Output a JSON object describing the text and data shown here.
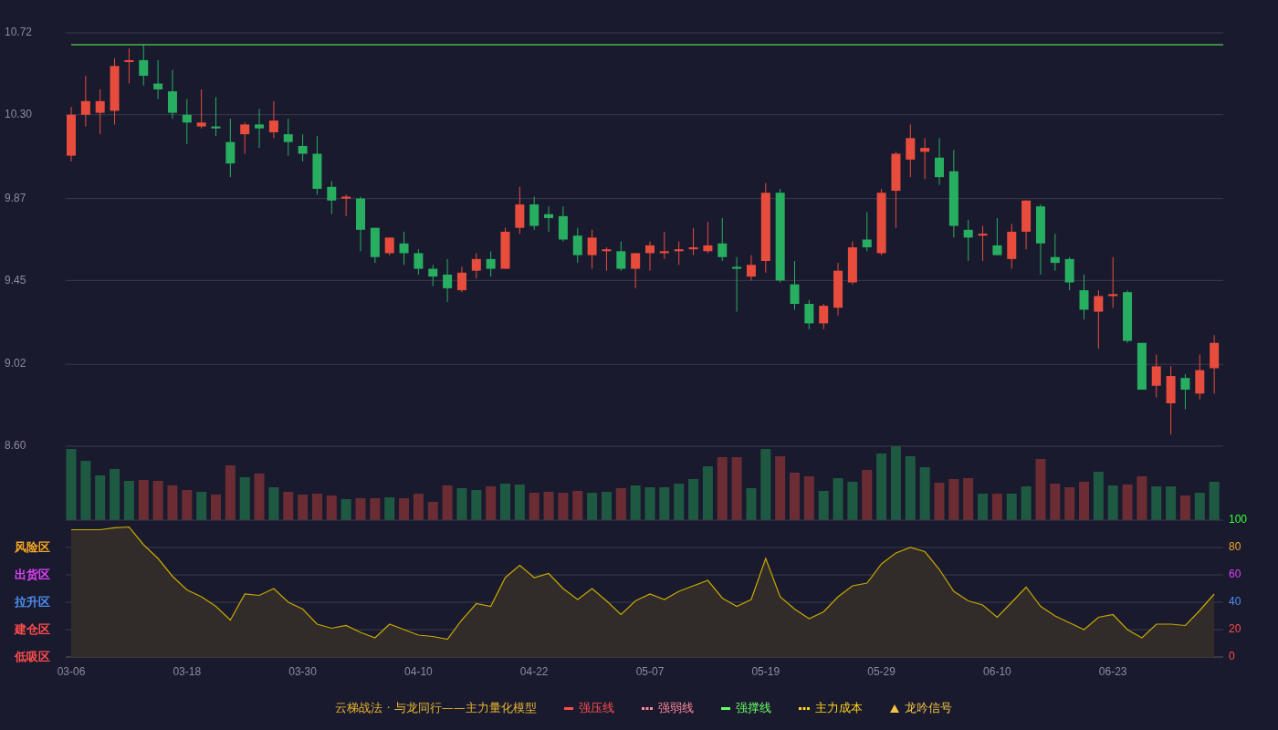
{
  "price_chart": {
    "chart_data": {
      "type": "candlestick",
      "ylim": [
        8.6,
        10.72
      ],
      "grid": true,
      "yticks": [
        {
          "value": 10.72,
          "label": "10.72"
        },
        {
          "value": 10.3,
          "label": "10.30"
        },
        {
          "value": 9.87,
          "label": "9.87"
        },
        {
          "value": 9.45,
          "label": "9.45"
        },
        {
          "value": 9.02,
          "label": "9.02"
        },
        {
          "value": 8.6,
          "label": "8.60"
        }
      ],
      "categories": [
        null,
        null,
        null,
        null,
        null,
        null,
        null,
        null,
        null,
        null,
        null,
        null,
        null,
        null,
        null,
        null,
        null,
        null,
        null,
        null,
        null,
        null,
        null,
        null,
        null,
        null,
        null,
        null,
        null,
        null,
        null,
        null,
        null,
        null,
        null,
        null,
        null,
        null,
        null,
        null,
        null,
        null,
        null,
        null,
        null,
        null,
        null,
        null,
        null,
        null,
        null,
        null,
        null,
        null,
        null,
        null,
        null,
        null,
        null,
        null,
        null,
        null,
        null,
        null,
        null,
        null,
        null,
        null,
        null,
        null,
        null,
        null,
        null,
        null,
        null,
        null,
        null,
        null,
        null,
        null
      ],
      "ohlc": [
        [
          10.09,
          10.34,
          10.06,
          10.3
        ],
        [
          10.3,
          10.5,
          10.24,
          10.37
        ],
        [
          10.31,
          10.43,
          10.2,
          10.37
        ],
        [
          10.32,
          10.59,
          10.25,
          10.55
        ],
        [
          10.57,
          10.64,
          10.46,
          10.58
        ],
        [
          10.58,
          10.66,
          10.45,
          10.5
        ],
        [
          10.46,
          10.58,
          10.38,
          10.43
        ],
        [
          10.42,
          10.53,
          10.28,
          10.31
        ],
        [
          10.3,
          10.38,
          10.15,
          10.26
        ],
        [
          10.24,
          10.43,
          10.23,
          10.26
        ],
        [
          10.24,
          10.39,
          10.19,
          10.23
        ],
        [
          10.16,
          10.28,
          9.98,
          10.05
        ],
        [
          10.2,
          10.26,
          10.1,
          10.25
        ],
        [
          10.25,
          10.33,
          10.13,
          10.23
        ],
        [
          10.21,
          10.37,
          10.18,
          10.27
        ],
        [
          10.2,
          10.28,
          10.09,
          10.16
        ],
        [
          10.14,
          10.2,
          10.06,
          10.1
        ],
        [
          10.1,
          10.19,
          9.89,
          9.92
        ],
        [
          9.93,
          9.96,
          9.79,
          9.86
        ],
        [
          9.87,
          9.89,
          9.78,
          9.88
        ],
        [
          9.87,
          9.88,
          9.6,
          9.71
        ],
        [
          9.72,
          9.72,
          9.54,
          9.57
        ],
        [
          9.59,
          9.67,
          9.58,
          9.67
        ],
        [
          9.64,
          9.7,
          9.53,
          9.59
        ],
        [
          9.59,
          9.61,
          9.48,
          9.51
        ],
        [
          9.51,
          9.53,
          9.42,
          9.47
        ],
        [
          9.48,
          9.56,
          9.34,
          9.41
        ],
        [
          9.4,
          9.52,
          9.39,
          9.49
        ],
        [
          9.5,
          9.59,
          9.46,
          9.56
        ],
        [
          9.56,
          9.6,
          9.47,
          9.51
        ],
        [
          9.51,
          9.72,
          9.51,
          9.7
        ],
        [
          9.72,
          9.93,
          9.69,
          9.84
        ],
        [
          9.84,
          9.88,
          9.71,
          9.73
        ],
        [
          9.79,
          9.83,
          9.7,
          9.77
        ],
        [
          9.78,
          9.83,
          9.65,
          9.66
        ],
        [
          9.68,
          9.72,
          9.54,
          9.58
        ],
        [
          9.58,
          9.71,
          9.51,
          9.67
        ],
        [
          9.6,
          9.62,
          9.5,
          9.61
        ],
        [
          9.6,
          9.65,
          9.5,
          9.51
        ],
        [
          9.51,
          9.59,
          9.41,
          9.59
        ],
        [
          9.59,
          9.65,
          9.5,
          9.63
        ],
        [
          9.59,
          9.7,
          9.56,
          9.6
        ],
        [
          9.6,
          9.65,
          9.53,
          9.61
        ],
        [
          9.61,
          9.72,
          9.58,
          9.62
        ],
        [
          9.6,
          9.75,
          9.59,
          9.63
        ],
        [
          9.64,
          9.77,
          9.55,
          9.57
        ],
        [
          9.52,
          9.57,
          9.29,
          9.51
        ],
        [
          9.47,
          9.58,
          9.45,
          9.53
        ],
        [
          9.55,
          9.95,
          9.49,
          9.9
        ],
        [
          9.9,
          9.92,
          9.44,
          9.45
        ],
        [
          9.43,
          9.55,
          9.3,
          9.33
        ],
        [
          9.33,
          9.35,
          9.2,
          9.23
        ],
        [
          9.23,
          9.33,
          9.2,
          9.32
        ],
        [
          9.31,
          9.54,
          9.27,
          9.5
        ],
        [
          9.44,
          9.65,
          9.43,
          9.62
        ],
        [
          9.66,
          9.8,
          9.6,
          9.62
        ],
        [
          9.59,
          9.92,
          9.58,
          9.9
        ],
        [
          9.91,
          10.11,
          9.72,
          10.1
        ],
        [
          10.07,
          10.25,
          9.98,
          10.18
        ],
        [
          10.11,
          10.18,
          9.97,
          10.13
        ],
        [
          10.08,
          10.18,
          9.94,
          9.98
        ],
        [
          10.01,
          10.12,
          9.67,
          9.73
        ],
        [
          9.71,
          9.76,
          9.55,
          9.67
        ],
        [
          9.68,
          9.73,
          9.55,
          9.69
        ],
        [
          9.63,
          9.77,
          9.58,
          9.58
        ],
        [
          9.56,
          9.74,
          9.51,
          9.7
        ],
        [
          9.7,
          9.86,
          9.61,
          9.86
        ],
        [
          9.83,
          9.84,
          9.48,
          9.64
        ],
        [
          9.57,
          9.69,
          9.5,
          9.54
        ],
        [
          9.56,
          9.57,
          9.4,
          9.44
        ],
        [
          9.4,
          9.48,
          9.25,
          9.3
        ],
        [
          9.29,
          9.4,
          9.1,
          9.37
        ],
        [
          9.37,
          9.57,
          9.31,
          9.38
        ],
        [
          9.39,
          9.4,
          9.13,
          9.14
        ],
        [
          9.13,
          9.13,
          8.89,
          8.89
        ],
        [
          8.91,
          9.07,
          8.85,
          9.01
        ],
        [
          8.82,
          9.01,
          8.66,
          8.96
        ],
        [
          8.95,
          8.97,
          8.79,
          8.89
        ],
        [
          8.87,
          9.07,
          8.84,
          8.99
        ],
        [
          9.0,
          9.17,
          8.87,
          9.13
        ]
      ]
    }
  },
  "oscillator": {
    "zones": [
      {
        "color": "#33ff33"
      },
      {
        "label": "风险区",
        "color": "#f5a623"
      },
      {
        "label": "出货区",
        "color": "#e040fb"
      },
      {
        "label": "拉升区",
        "color": "#4d8ef0"
      },
      {
        "label": "建仓区",
        "color": "#ff4d4d"
      },
      {
        "label": "低吸区",
        "color": "#ff4d4d"
      }
    ],
    "chart_data": {
      "type": "area",
      "ylim": [
        0,
        100
      ],
      "grid": true,
      "categories": [
        "03-06",
        null,
        null,
        null,
        null,
        null,
        null,
        null,
        "03-18",
        null,
        null,
        null,
        null,
        null,
        null,
        null,
        "03-30",
        null,
        null,
        null,
        null,
        null,
        null,
        null,
        "04-10",
        null,
        null,
        null,
        null,
        null,
        null,
        null,
        "04-22",
        null,
        null,
        null,
        null,
        null,
        null,
        null,
        "05-07",
        null,
        null,
        null,
        null,
        null,
        null,
        null,
        "05-19",
        null,
        null,
        null,
        null,
        null,
        null,
        null,
        "05-29",
        null,
        null,
        null,
        null,
        null,
        null,
        null,
        "06-10",
        null,
        null,
        null,
        null,
        null,
        null,
        null,
        "06-23",
        null,
        null,
        null,
        null,
        null,
        null,
        null
      ],
      "yticks": [
        {
          "value": 100,
          "label": "100"
        },
        {
          "value": 80,
          "label": "80"
        },
        {
          "value": 60,
          "label": "60"
        },
        {
          "value": 40,
          "label": "40"
        },
        {
          "value": 20,
          "label": "20"
        },
        {
          "value": 0,
          "label": "0"
        }
      ],
      "series": [
        {
          "color": "#c8a800",
          "values": [
            93,
            93,
            93,
            94.5,
            95,
            82,
            72,
            59,
            49,
            44,
            37,
            27,
            46,
            45,
            50,
            40,
            35,
            24,
            21,
            23,
            18,
            14,
            24,
            20,
            16,
            15,
            13,
            27,
            39,
            37,
            58,
            67,
            58,
            61,
            50,
            42,
            50,
            41,
            31,
            41,
            46,
            42,
            48,
            52,
            56,
            43,
            37,
            42,
            72,
            44,
            35,
            28,
            33,
            44,
            52,
            54,
            68,
            76,
            80,
            77,
            64,
            48,
            41,
            38,
            29,
            40,
            51,
            37,
            30,
            25,
            20,
            29,
            31,
            20,
            14,
            24,
            24,
            23,
            34,
            46
          ]
        }
      ]
    }
  },
  "legend": {
    "title": "云梯战法 · 与龙同行——主力量化模型",
    "items": [
      {
        "kind": "solid",
        "label": "强压线",
        "color": "#ff4d4d"
      },
      {
        "kind": "dashed",
        "label": "强弱线",
        "color": "#ff8a9a"
      },
      {
        "kind": "solid",
        "label": "强撑线",
        "color": "#66ff66"
      },
      {
        "kind": "dashed",
        "label": "主力成本",
        "color": "#ffd21f"
      },
      {
        "kind": "triangle",
        "label": "龙吟信号",
        "color": "#f5c542"
      }
    ]
  }
}
